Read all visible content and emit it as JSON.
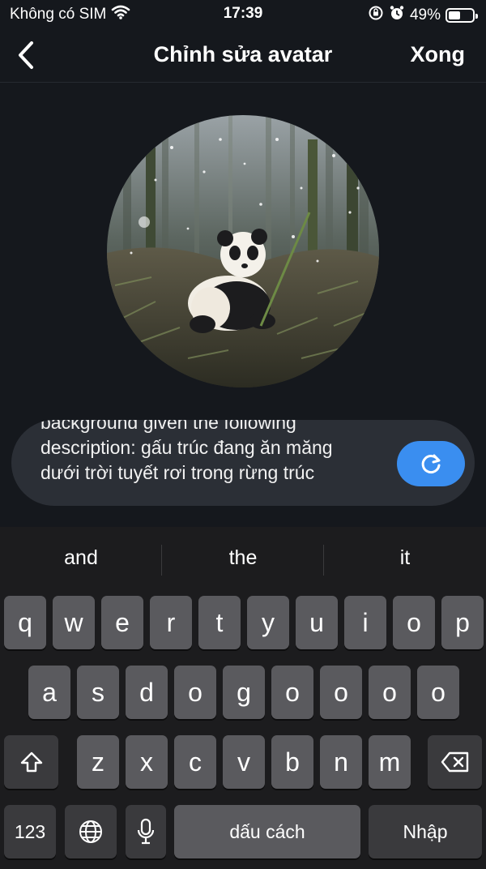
{
  "status_bar": {
    "carrier": "Không có SIM",
    "time": "17:39",
    "battery_percent": "49%",
    "battery_level": 0.49
  },
  "nav": {
    "title": "Chỉnh sửa avatar",
    "done_label": "Xong"
  },
  "prompt": {
    "text": "background given the following\ndescription: gấu trúc đang ăn măng\ndưới trời tuyết rơi trong rừng trúc"
  },
  "keyboard": {
    "suggestions": [
      "and",
      "the",
      "it"
    ],
    "row1": [
      "q",
      "w",
      "e",
      "r",
      "t",
      "y",
      "u",
      "i",
      "o",
      "p"
    ],
    "row2": [
      "a",
      "s",
      "d",
      "o",
      "g",
      "o",
      "o",
      "o",
      "o"
    ],
    "row3": [
      "z",
      "x",
      "c",
      "v",
      "b",
      "n",
      "m"
    ],
    "numbers_label": "123",
    "space_label": "dấu cách",
    "return_label": "Nhập"
  }
}
